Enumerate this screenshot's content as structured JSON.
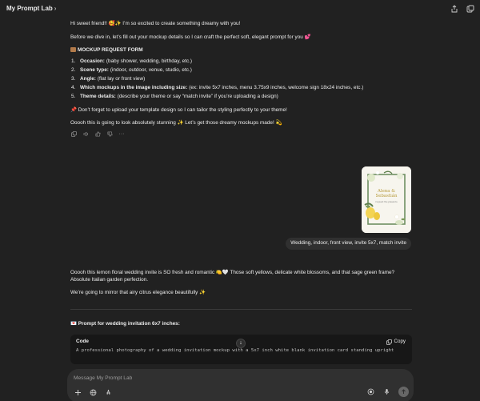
{
  "header": {
    "gpt_name": "My Prompt Lab",
    "icons": [
      "share-icon",
      "new-chat-icon"
    ]
  },
  "assistant1": {
    "greeting": "Hi sweet friend!! 🥰✨ I’m so excited to create something dreamy with you!",
    "intro": "Before we dive in, let’s fill out your mockup details so I can craft the perfect soft, elegant prompt for you 💕",
    "form_title": "MOCKUP REQUEST FORM",
    "form_items": [
      {
        "num": "1.",
        "label": "Occasion:",
        "desc": "(baby shower, wedding, birthday, etc.)"
      },
      {
        "num": "2.",
        "label": "Scene type:",
        "desc": "(indoor, outdoor, venue, studio, etc.)"
      },
      {
        "num": "3.",
        "label": "Angle:",
        "desc": "(flat lay or front view)"
      },
      {
        "num": "4.",
        "label": "Which mockups in the image including size:",
        "desc": "(ex: invite 5x7 inches, menu 3.75x9 inches, welcome sign 18x24 inches, etc.)"
      },
      {
        "num": "5.",
        "label": "Theme details:",
        "desc": "(describe your theme or say “match invite” if you’re uploading a design)"
      }
    ],
    "reminder": "📌 Don’t forget to upload your template design so I can tailor the styling perfectly to your theme!",
    "closing": "Ooooh this is going to look absolutely stunning ✨ Let’s get those dreamy mockups made! 💫"
  },
  "user_message": {
    "invite_text": {
      "title": "Alena &",
      "title2": "Sebastián",
      "sub": "request the pleasure"
    },
    "bubble": "Wedding, indoor, front view, invite 5x7, match invite"
  },
  "assistant2": {
    "line1": "Ooooh this lemon floral wedding invite is SO fresh and romantic 🍋🤍 Those soft yellows, delicate white blossoms, and that sage green frame?",
    "line2": "Absolute Italian garden perfection.",
    "line3": "We’re going to mirror that airy citrus elegance beautifully ✨",
    "prompt_title": "💌 Prompt for wedding invitation 6x7 inches:",
    "code_label": "Code",
    "copy_label": "Copy",
    "code_text": "A professional photography of a wedding invitation mockup with a 5x7 inch white blank invitation card standing upright"
  },
  "composer": {
    "placeholder": "Message My Prompt Lab"
  },
  "colors": {
    "background": "#212121",
    "bubble": "#303030",
    "code_bg": "#171717",
    "text": "#ececec"
  }
}
